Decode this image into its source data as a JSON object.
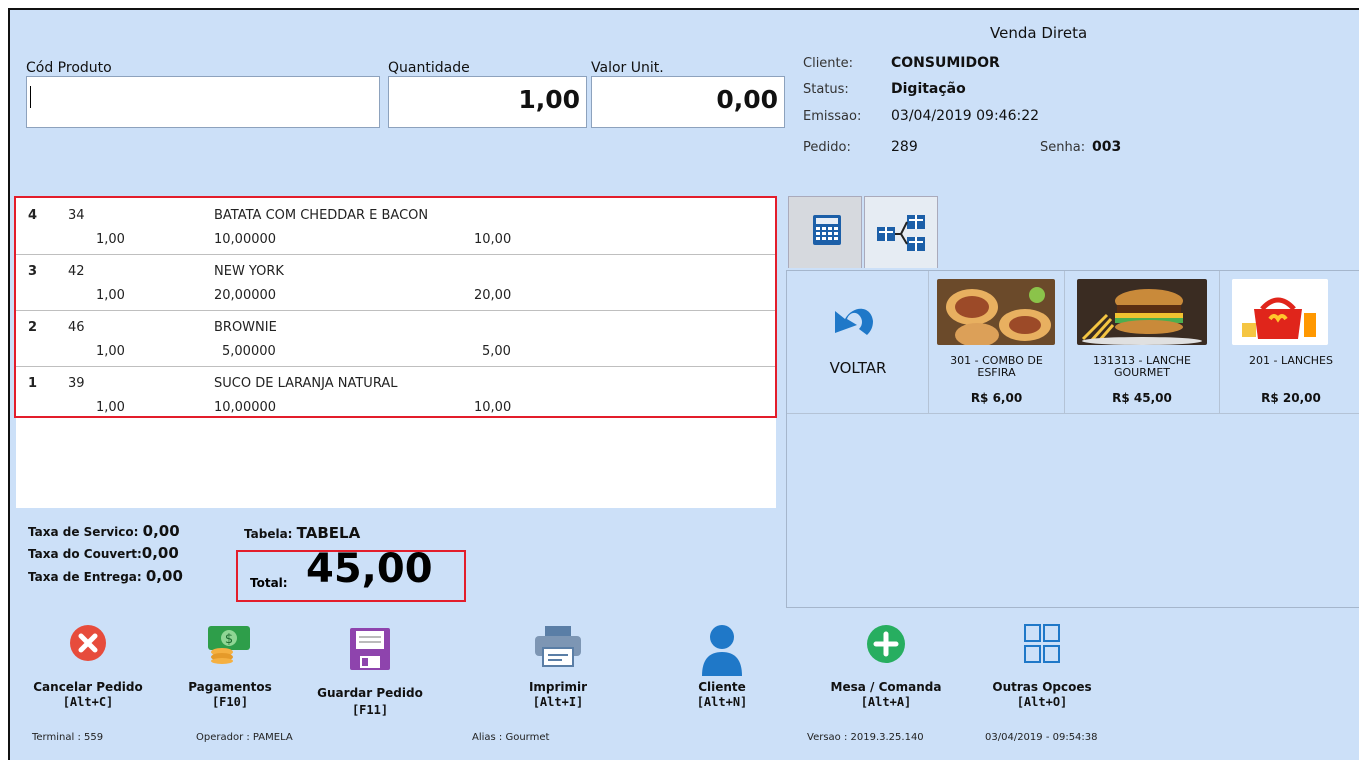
{
  "header": {
    "title": "Venda Direta"
  },
  "entry": {
    "cod_label": "Cód Produto",
    "cod_value": "",
    "qty_label": "Quantidade",
    "qty_value": "1,00",
    "unit_label": "Valor Unit.",
    "unit_value": "0,00"
  },
  "info": {
    "cliente_label": "Cliente:",
    "cliente_value": "CONSUMIDOR",
    "status_label": "Status:",
    "status_value": "Digitação",
    "emissao_label": "Emissao:",
    "emissao_value": "03/04/2019 09:46:22",
    "pedido_label": "Pedido:",
    "pedido_value": "289",
    "senha_label": "Senha:",
    "senha_value": "003"
  },
  "items": [
    {
      "seq": "4",
      "code": "34",
      "name": "BATATA COM CHEDDAR E BACON",
      "qty": "1,00",
      "unit": "10,00000",
      "total": "10,00"
    },
    {
      "seq": "3",
      "code": "42",
      "name": "NEW YORK",
      "qty": "1,00",
      "unit": "20,00000",
      "total": "20,00"
    },
    {
      "seq": "2",
      "code": "46",
      "name": "BROWNIE",
      "qty": "1,00",
      "unit": "5,00000",
      "total": "5,00"
    },
    {
      "seq": "1",
      "code": "39",
      "name": "SUCO DE LARANJA NATURAL",
      "qty": "1,00",
      "unit": "10,00000",
      "total": "10,00"
    }
  ],
  "taxes": {
    "servico_label": "Taxa de Servico:",
    "servico_value": "0,00",
    "couvert_label": "Taxa do Couvert:",
    "couvert_value": "0,00",
    "entrega_label": "Taxa de Entrega:",
    "entrega_value": "0,00"
  },
  "tabela": {
    "label": "Tabela:",
    "value": "TABELA"
  },
  "total": {
    "label": "Total:",
    "value": "45,00"
  },
  "tabs": [
    {
      "icon": "calculator-icon"
    },
    {
      "icon": "tree-structure-icon"
    }
  ],
  "products": {
    "back_label": "VOLTAR",
    "items": [
      {
        "name_line1": "301 - COMBO DE",
        "name_line2": "ESFIRA",
        "price": "R$ 6,00"
      },
      {
        "name_line1": "131313 - LANCHE",
        "name_line2": "GOURMET",
        "price": "R$ 45,00"
      },
      {
        "name_line1": "201 - LANCHES",
        "name_line2": "",
        "price": "R$ 20,00"
      }
    ]
  },
  "actions": [
    {
      "label": "Cancelar Pedido",
      "shortcut": "[Alt+C]",
      "icon": "cancel-x-icon"
    },
    {
      "label": "Pagamentos",
      "shortcut": "[F10]",
      "icon": "money-icon"
    },
    {
      "label": "Guardar Pedido",
      "shortcut": "[F11]",
      "icon": "floppy-disk-icon"
    },
    {
      "label": "Imprimir",
      "shortcut": "[Alt+I]",
      "icon": "printer-icon"
    },
    {
      "label": "Cliente",
      "shortcut": "[Alt+N]",
      "icon": "user-icon"
    },
    {
      "label": "Mesa / Comanda",
      "shortcut": "[Alt+A]",
      "icon": "plus-circle-icon"
    },
    {
      "label": "Outras Opcoes",
      "shortcut": "[Alt+O]",
      "icon": "grid-icon"
    }
  ],
  "footer": {
    "terminal": "Terminal : 559",
    "operador": "Operador : PAMELA",
    "alias": "Alias : Gourmet",
    "versao": "Versao : 2019.3.25.140",
    "datetime": "03/04/2019 - 09:54:38"
  },
  "colors": {
    "background": "#cce0f8",
    "highlight": "#e31d2b",
    "cancel": "#e74c3c",
    "save": "#8e44ad",
    "client": "#1f78c8",
    "add": "#27ae60"
  }
}
